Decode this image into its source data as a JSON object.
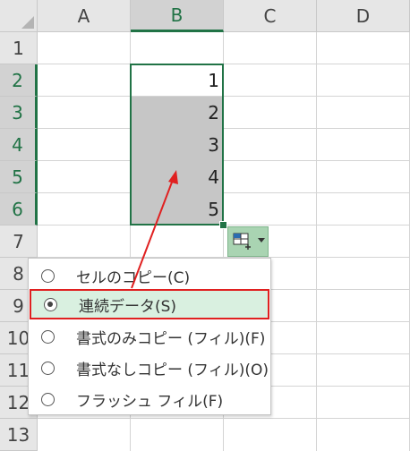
{
  "columns": [
    "A",
    "B",
    "C",
    "D"
  ],
  "rows": [
    "1",
    "2",
    "3",
    "4",
    "5",
    "6",
    "7",
    "8",
    "9",
    "10",
    "11",
    "12",
    "13"
  ],
  "selected_column": "B",
  "selected_rows": [
    "2",
    "3",
    "4",
    "5",
    "6"
  ],
  "cells": [
    {
      "row": "2",
      "col": "B",
      "value": "1"
    },
    {
      "row": "3",
      "col": "B",
      "value": "2"
    },
    {
      "row": "4",
      "col": "B",
      "value": "3"
    },
    {
      "row": "5",
      "col": "B",
      "value": "4"
    },
    {
      "row": "6",
      "col": "B",
      "value": "5"
    }
  ],
  "autofill_menu": {
    "items": [
      {
        "label": "セルのコピー(C)",
        "selected": false
      },
      {
        "label": "連続データ(S)",
        "selected": true
      },
      {
        "label": "書式のみコピー (フィル)(F)",
        "selected": false
      },
      {
        "label": "書式なしコピー (フィル)(O)",
        "selected": false
      },
      {
        "label": "フラッシュ フィル(F)",
        "selected": false
      }
    ]
  },
  "colors": {
    "excel_green": "#217346",
    "highlight_border": "#e02020",
    "highlight_fill": "#d9f0e0",
    "annotation_arrow": "#e02020"
  },
  "icons": {
    "corner": "select-all-triangle",
    "smart_tag": "auto-fill-options-icon",
    "dropdown": "chevron-down-icon"
  }
}
